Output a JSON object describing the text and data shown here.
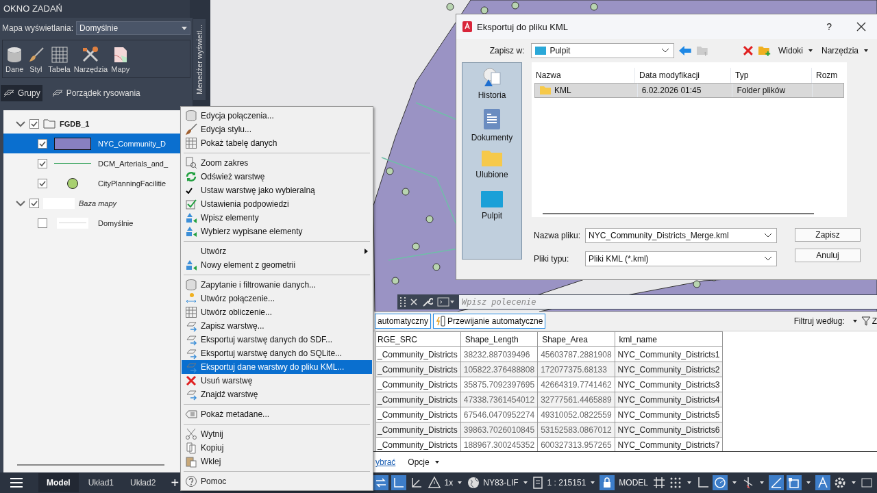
{
  "task_pane": {
    "title": "OKNO ZADAŃ",
    "display_map_label": "Mapa wyświetlania:",
    "display_map_value": "Domyślnie",
    "tools": [
      {
        "label": "Dane"
      },
      {
        "label": "Styl"
      },
      {
        "label": "Tabela"
      },
      {
        "label": "Narzędzia"
      },
      {
        "label": "Mapy"
      }
    ],
    "view_tabs": [
      {
        "label": "Grupy",
        "selected": true
      },
      {
        "label": "Porządek rysowania",
        "selected": false
      }
    ],
    "side_tab": "Menedżer wyświetl...",
    "tree": [
      {
        "label": "FGDB_1",
        "kind": "group",
        "checked": true,
        "expanded": true,
        "selected": false,
        "children": [
          {
            "label": "NYC_Community_D",
            "kind": "polygon",
            "color": "#8880c0",
            "checked": true,
            "selected": true
          },
          {
            "label": "DCM_Arterials_and_",
            "kind": "line",
            "color": "#1f9a4a",
            "checked": true,
            "selected": false
          },
          {
            "label": "CityPlanningFacilitie",
            "kind": "point",
            "color": "#a8d070",
            "checked": true,
            "selected": false
          }
        ]
      },
      {
        "label": "Baza mapy",
        "kind": "basemap",
        "checked": true,
        "expanded": true,
        "selected": false,
        "children": [
          {
            "label": "Domyślnie",
            "kind": "blank",
            "color": "#d0d0d0",
            "checked": false,
            "selected": false
          }
        ]
      }
    ]
  },
  "context_menu": [
    {
      "kind": "item",
      "label": "Edycja połączenia...",
      "selected": false
    },
    {
      "kind": "item",
      "label": "Edycja stylu...",
      "selected": false
    },
    {
      "kind": "item",
      "label": "Pokaż tabelę danych",
      "selected": false
    },
    {
      "kind": "separator"
    },
    {
      "kind": "item",
      "label": "Zoom zakres",
      "selected": false
    },
    {
      "kind": "item",
      "label": "Odśwież warstwę",
      "selected": false
    },
    {
      "kind": "check",
      "label": "Ustaw warstwę jako wybieralną",
      "checked": true,
      "selected": false
    },
    {
      "kind": "item",
      "label": "Ustawienia podpowiedzi",
      "selected": false
    },
    {
      "kind": "item",
      "label": "Wpisz elementy",
      "selected": false
    },
    {
      "kind": "item",
      "label": "Wybierz wypisane elementy",
      "selected": false
    },
    {
      "kind": "separator"
    },
    {
      "kind": "submenu",
      "label": "Utwórz",
      "selected": false
    },
    {
      "kind": "item",
      "label": "Nowy element z geometrii",
      "selected": false
    },
    {
      "kind": "separator"
    },
    {
      "kind": "item",
      "label": "Zapytanie i filtrowanie danych...",
      "selected": false
    },
    {
      "kind": "item",
      "label": "Utwórz połączenie...",
      "selected": false
    },
    {
      "kind": "item",
      "label": "Utwórz obliczenie...",
      "selected": false
    },
    {
      "kind": "item",
      "label": "Zapisz warstwę...",
      "selected": false
    },
    {
      "kind": "item",
      "label": "Eksportuj warstwę danych do SDF...",
      "selected": false
    },
    {
      "kind": "item",
      "label": "Eksportuj warstwę danych do SQLite...",
      "selected": false
    },
    {
      "kind": "item",
      "label": "Eksportuj dane warstwy do pliku KML...",
      "selected": true
    },
    {
      "kind": "item",
      "label": "Usuń warstwę",
      "selected": false
    },
    {
      "kind": "item",
      "label": "Znajdź warstwę",
      "selected": false
    },
    {
      "kind": "separator"
    },
    {
      "kind": "item",
      "label": "Pokaż metadane...",
      "selected": false
    },
    {
      "kind": "separator"
    },
    {
      "kind": "item",
      "label": "Wytnij",
      "selected": false
    },
    {
      "kind": "item",
      "label": "Kopiuj",
      "selected": false
    },
    {
      "kind": "item",
      "label": "Wklej",
      "selected": false
    },
    {
      "kind": "separator"
    },
    {
      "kind": "item",
      "label": "Pomoc",
      "selected": false
    }
  ],
  "dialog": {
    "title": "Eksportuj do pliku KML",
    "help": "?",
    "save_in_label": "Zapisz w:",
    "save_in_value": "Pulpit",
    "views": "Widoki",
    "tools": "Narzędzia",
    "places": [
      {
        "label": "Historia"
      },
      {
        "label": "Dokumenty"
      },
      {
        "label": "Ulubione"
      },
      {
        "label": "Pulpit"
      }
    ],
    "columns": [
      "Nazwa",
      "Data modyfikacji",
      "Typ",
      "Rozm"
    ],
    "files": [
      {
        "name": "KML",
        "modified": "6.02.2026 01:45",
        "type": "Folder plików",
        "selected": true
      }
    ],
    "file_name_label": "Nazwa pliku:",
    "file_name": "NYC_Community_Districts_Merge.kml",
    "file_type_label": "Pliki typu:",
    "file_type": "Pliki KML (*.kml)",
    "buttons": [
      "Zapisz",
      "Anuluj"
    ]
  },
  "command_line": {
    "placeholder": "Wpisz polecenie"
  },
  "data_table": {
    "toolbar": [
      "automatyczny",
      "Przewijanie automatyczne"
    ],
    "filter_label": "Filtruj według:",
    "filter_button": "Z",
    "columns": [
      "RGE_SRC",
      "Shape_Length",
      "Shape_Area",
      "kml_name"
    ],
    "rows": [
      [
        "_Community_Districts",
        "38232.887039496",
        "45603787.2881908",
        "NYC_Community_Districts1"
      ],
      [
        "_Community_Districts",
        "105822.376488808",
        "172077375.68133",
        "NYC_Community_Districts2"
      ],
      [
        "_Community_Districts",
        "35875.7092397695",
        "42664319.7741462",
        "NYC_Community_Districts3"
      ],
      [
        "_Community_Districts",
        "47338.7361454012",
        "32777561.4465889",
        "NYC_Community_Districts4"
      ],
      [
        "_Community_Districts",
        "67546.0470952274",
        "49310052.0822559",
        "NYC_Community_Districts5"
      ],
      [
        "_Community_Districts",
        "39863.7026010845",
        "53152583.0867012",
        "NYC_Community_Districts6"
      ],
      [
        "_Community_Districts",
        "188967.300245352",
        "600327313.957265",
        "NYC_Community_Districts7"
      ]
    ],
    "footer": [
      "ybrać",
      "Opcje"
    ]
  },
  "status_bar": {
    "tabs": [
      {
        "label": "Model",
        "selected": true
      },
      {
        "label": "Układ1",
        "selected": false
      },
      {
        "label": "Układ2",
        "selected": false
      }
    ],
    "add": "+",
    "scale_factor": "1x",
    "coord_system": "NY83-LIF",
    "scale": "1 : 215151",
    "space": "MODEL"
  }
}
